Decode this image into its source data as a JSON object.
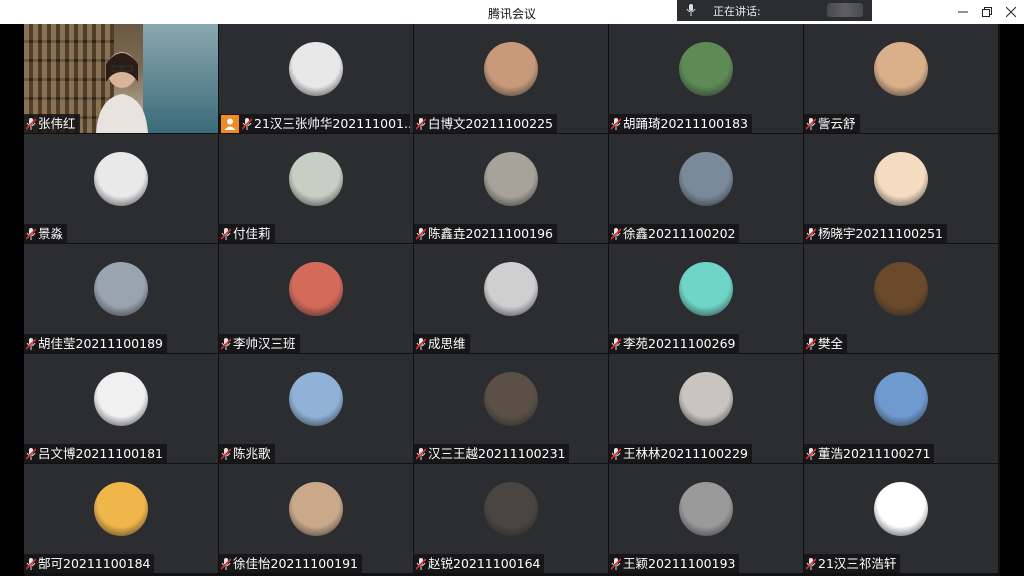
{
  "window": {
    "title": "腾讯会议"
  },
  "speaking": {
    "label": "正在讲话:"
  },
  "participants": [
    {
      "name": "张伟红",
      "video": true
    },
    {
      "name": "21汉三张帅华202111001...",
      "host": true,
      "color": "#e8e8e8"
    },
    {
      "name": "白博文20211100225",
      "color": "#c89a7a"
    },
    {
      "name": "胡踊琦20211100183",
      "color": "#5d8a55"
    },
    {
      "name": "訾云舒",
      "color": "#d9b08a"
    },
    {
      "name": "景淼",
      "color": "#e9e9e9"
    },
    {
      "name": "付佳莉",
      "color": "#c7cfc4"
    },
    {
      "name": "陈鑫垚20211100196",
      "color": "#a8a39a"
    },
    {
      "name": "徐鑫20211100202",
      "color": "#7a8a9a"
    },
    {
      "name": "杨晓宇20211100251",
      "color": "#f3dcc0"
    },
    {
      "name": "胡佳莹20211100189",
      "color": "#9aa3b0"
    },
    {
      "name": "李帅汉三班",
      "color": "#d46a5a"
    },
    {
      "name": "成思维",
      "color": "#cfcfcf"
    },
    {
      "name": "李苑20211100269",
      "color": "#6fd6c7"
    },
    {
      "name": "樊全",
      "color": "#6a4a2a"
    },
    {
      "name": "吕文博20211100181",
      "color": "#f0f0f0"
    },
    {
      "name": "陈兆歌",
      "color": "#8fb2d6"
    },
    {
      "name": "汉三王越20211100231",
      "color": "#5a5046"
    },
    {
      "name": "王林林20211100229",
      "color": "#c9c4bd"
    },
    {
      "name": "董浩20211100271",
      "color": "#6f9ad0"
    },
    {
      "name": "郜可20211100184",
      "color": "#f1b64a"
    },
    {
      "name": "徐佳怡20211100191",
      "color": "#c9a98a"
    },
    {
      "name": "赵锐20211100164",
      "color": "#4a4540"
    },
    {
      "name": "王颖20211100193",
      "color": "#9a9a9a"
    },
    {
      "name": "21汉三祁浩轩",
      "color": "#ffffff"
    }
  ]
}
